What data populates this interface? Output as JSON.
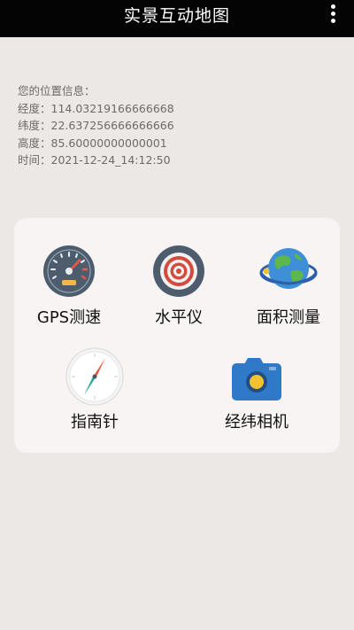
{
  "app": {
    "title": "实景互动地图",
    "menu_icon": "more-vertical-icon"
  },
  "location": {
    "header": "您的位置信息：",
    "longitude": "经度：114.03219166666668",
    "latitude": "纬度：22.637256666666666",
    "altitude": "高度：85.60000000000001",
    "time": "时间：2021-12-24_14:12:50"
  },
  "tools": [
    {
      "label": "GPS测速",
      "icon": "speedometer-icon"
    },
    {
      "label": "水平仪",
      "icon": "target-icon"
    },
    {
      "label": "面积测量",
      "icon": "globe-icon"
    },
    {
      "label": "指南针",
      "icon": "compass-icon"
    },
    {
      "label": "经纬相机",
      "icon": "camera-icon"
    }
  ]
}
